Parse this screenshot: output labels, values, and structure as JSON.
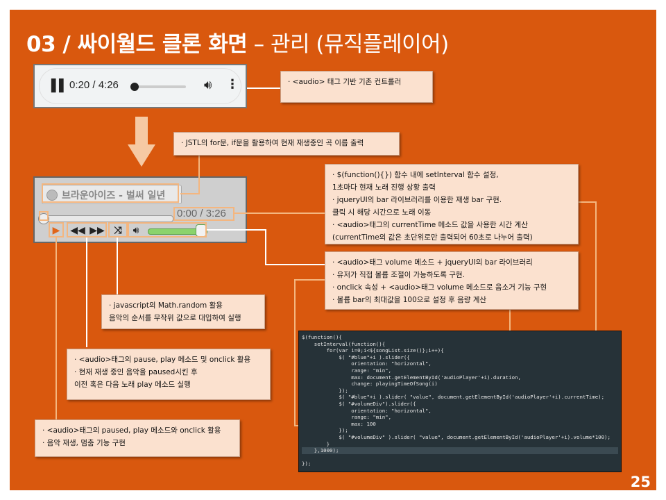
{
  "slide": {
    "title_main": "03 / 싸이월드 클론 화면",
    "title_sub": " – 관리 (뮤직플레이어)",
    "page_number": "25"
  },
  "native_audio": {
    "time": "0:20 / 4:26",
    "progress_fraction": 0.07,
    "icons": [
      "pause-icon",
      "volume-icon",
      "more-vert-icon"
    ]
  },
  "custom_player": {
    "song_title": "브라운아이즈 - 벌써 일년",
    "time": "0:00 / 3:26",
    "controls": [
      "play-icon",
      "previous-icon",
      "next-icon",
      "shuffle-icon",
      "volume-icon"
    ],
    "volume_fraction": 1.0
  },
  "notes": {
    "audio_tag": [
      "· <audio> 태그 기반 기존 컨트롤러"
    ],
    "jstl": [
      "· JSTL의 for문, if문을 활용하여 현재 재생중인 곡 이름 출력"
    ],
    "interval": [
      "· $(function(){}) 함수 내에 setInterval 함수 설정,",
      "  1초마다 현재 노래 진행 상황 출력",
      "· jqueryUI의 bar 라이브러리를 이용한 재생 bar 구현.",
      "  클릭 시 해당 시간으로 노래 이동",
      "· <audio>태그의 currentTime 메소드 값을 사용한 시간 계산",
      "  (currentTime의 값은 초단위로만 출력되어 60초로 나누어 출력)"
    ],
    "volume": [
      "· <audio>태그 volume 메소드 + jqueryUI의 bar 라이브러리",
      "· 유저가 직접 볼륨 조절이 가능하도록 구현.",
      "· onclick 속성 + <audio>태그 volume 메소드로 음소거 기능 구현",
      "· 볼륨 bar의 최대값을 100으로 설정 후 음량 계산"
    ],
    "random": [
      "· javascript의 Math.random 활용",
      "  음악의 순서를 무작위 값으로 대입하여 실행"
    ],
    "pause": [
      "· <audio>태그의 pause, play 메소드 및 onclick 활용",
      "· 현재 재생 중인 음악을 paused시킨 후",
      "  이전 혹은 다음 노래 play 메소드 실행"
    ],
    "paused": [
      "· <audio>태그의 paused, play 메소드와 onclick 활용",
      "· 음악 재생, 멈춤 기능 구현"
    ]
  },
  "code_lines": [
    "$(function(){",
    "    setInterval(function(){",
    "        for(var i=0;i<${songList.size()};i++){",
    "            $( \"#blue\"+i ).slider({",
    "                orientation: \"horizontal\",",
    "                range: \"min\",",
    "                max: document.getElementById('audioPlayer'+i).duration,",
    "                change: playingTimeOfSong(i)",
    "            });",
    "            $( \"#blue\"+i ).slider( \"value\", document.getElementById('audioPlayer'+i).currentTime);",
    "            $( \"#volumeDiv\").slider({",
    "                orientation: \"horizontal\",",
    "                range: \"min\",",
    "                max: 100",
    "            });",
    "            $( \"#volumeDiv\" ).slider( \"value\", document.getElementById('audioPlayer'+i).volume*100);",
    "        }",
    "    },1000);",
    "",
    "});"
  ],
  "colors": {
    "background": "#d9580e",
    "accent_line": "#f4b67f",
    "note_fill": "#fbe1cf",
    "code_bg": "#263238",
    "volume_green": "#8ad36b"
  }
}
